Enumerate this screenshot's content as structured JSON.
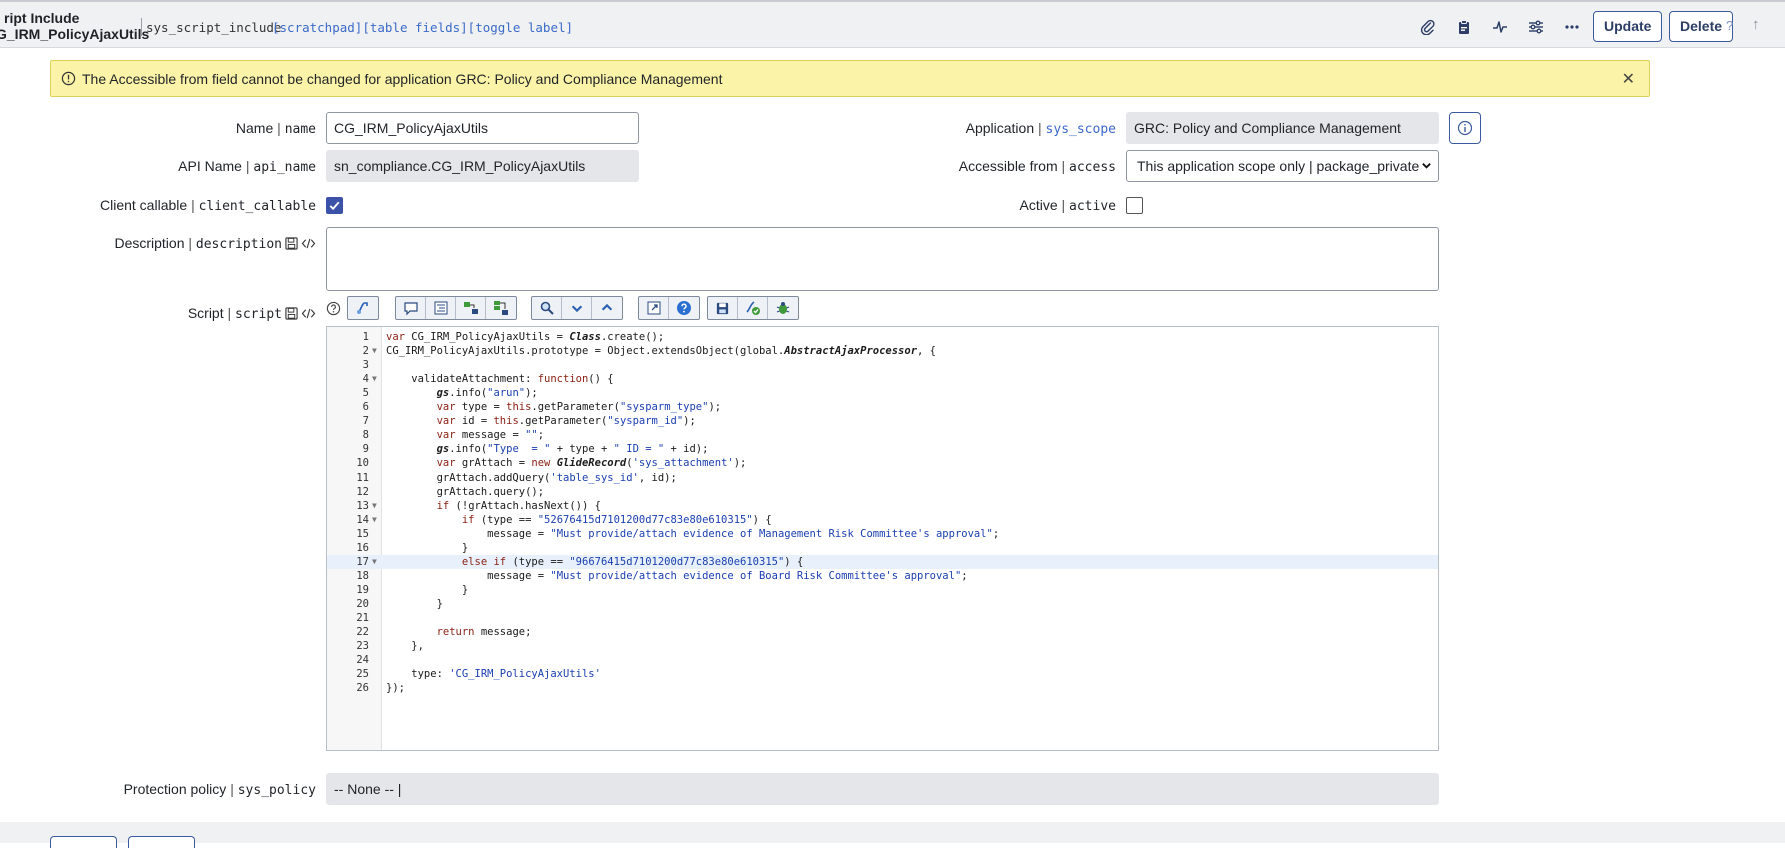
{
  "header": {
    "title_line1": "ript Include",
    "title_line2": "G_IRM_PolicyAjaxUtils",
    "table_name": "sys_script_include",
    "links": [
      "[scratchpad]",
      "[table fields]",
      "[toggle label]"
    ],
    "icons": [
      "paperclip-icon",
      "clipboard-icon",
      "activity-icon",
      "sliders-icon",
      "more-icon"
    ],
    "update_label": "Update",
    "delete_label": "Delete",
    "help_glyph": "?",
    "up_glyph": "↑"
  },
  "alert": {
    "text": "The Accessible from field cannot be changed for application GRC: Policy and Compliance Management",
    "close_glyph": "✕"
  },
  "form": {
    "name": {
      "label": "Name",
      "field": "name",
      "value": "CG_IRM_PolicyAjaxUtils"
    },
    "api_name": {
      "label": "API Name",
      "field": "api_name",
      "value": "sn_compliance.CG_IRM_PolicyAjaxUtils"
    },
    "client_callable": {
      "label": "Client callable",
      "field": "client_callable",
      "checked": true
    },
    "description": {
      "label": "Description",
      "field": "description",
      "value": ""
    },
    "script": {
      "label": "Script",
      "field": "script"
    },
    "application": {
      "label": "Application",
      "field": "sys_scope",
      "value": "GRC: Policy and Compliance Management"
    },
    "accessible_from": {
      "label": "Accessible from",
      "field": "access",
      "value": "This application scope only | package_private"
    },
    "active": {
      "label": "Active",
      "field": "active",
      "checked": false
    },
    "protection_policy": {
      "label": "Protection policy",
      "field": "sys_policy",
      "value": "-- None -- |"
    }
  },
  "label_separator": "|",
  "toolbar": {
    "group1": [
      "script-include-icon"
    ],
    "group2": [
      "comment-icon",
      "format-icon",
      "replace-icon",
      "replace-all-icon"
    ],
    "group3": [
      "search-icon",
      "fold-down-icon",
      "fold-up-icon"
    ],
    "group4": [
      "fullscreen-icon",
      "help-icon"
    ],
    "group5": [
      "save-icon",
      "script-debugger-icon",
      "debug-icon"
    ]
  },
  "code_lines": [
    "var CG_IRM_PolicyAjaxUtils = Class.create();",
    "CG_IRM_PolicyAjaxUtils.prototype = Object.extendsObject(global.AbstractAjaxProcessor, {",
    "",
    "    validateAttachment: function() {",
    "        gs.info(\"arun\");",
    "        var type = this.getParameter(\"sysparm_type\");",
    "        var id = this.getParameter(\"sysparm_id\");",
    "        var message = \"\";",
    "        gs.info(\"Type  = \" + type + \" ID = \" + id);",
    "        var grAttach = new GlideRecord('sys_attachment');",
    "        grAttach.addQuery('table_sys_id', id);",
    "        grAttach.query();",
    "        if (!grAttach.hasNext()) {",
    "            if (type == \"52676415d7101200d77c83e80e610315\") {",
    "                message = \"Must provide/attach evidence of Management Risk Committee's approval\";",
    "            }",
    "            else if (type == \"96676415d7101200d77c83e80e610315\") {",
    "                message = \"Must provide/attach evidence of Board Risk Committee's approval\";",
    "            }",
    "        }",
    "",
    "        return message;",
    "    },",
    "",
    "    type: 'CG_IRM_PolicyAjaxUtils'",
    "});"
  ],
  "fold_lines": [
    2,
    4,
    13,
    14,
    17
  ],
  "highlighted_line": 17,
  "colors": {
    "accent": "#3b52a8",
    "alert_bg": "#fbf4a8",
    "header_bg": "#f0f1f3",
    "readonly_bg": "#e4e6e9"
  }
}
